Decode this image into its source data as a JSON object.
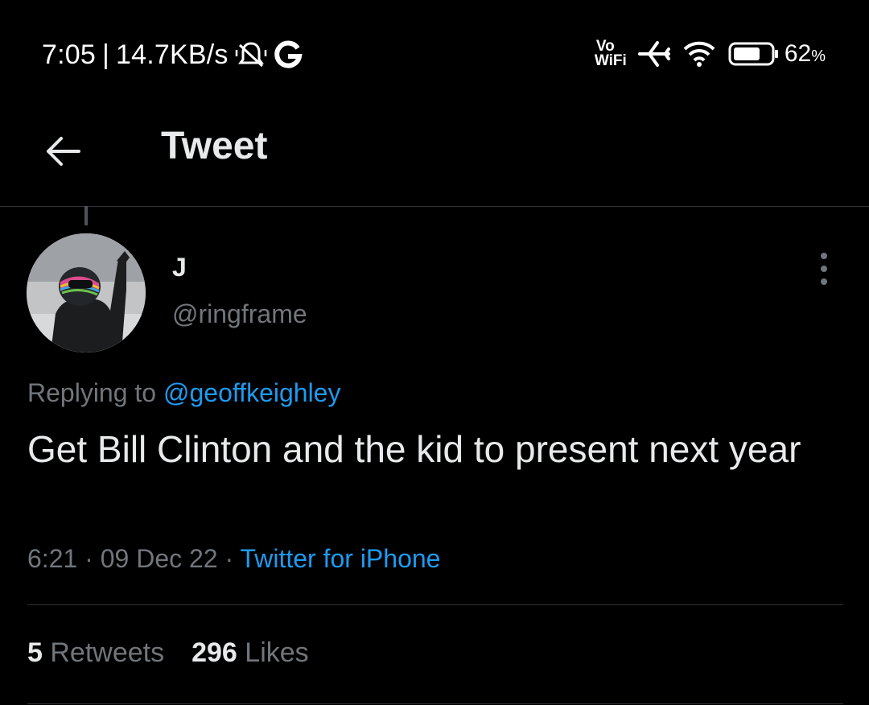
{
  "status_bar": {
    "time": "7:05",
    "separator": "|",
    "speed": "14.7KB/s",
    "icons_left": [
      "silent-bell-icon",
      "google-g-icon"
    ],
    "vo": "Vo",
    "wifi_label": "WiFi",
    "icons_right": [
      "airplane-icon",
      "wifi-signal-icon",
      "battery-icon"
    ],
    "battery_value": "62",
    "battery_unit": "%"
  },
  "header": {
    "back_icon": "arrow-left-icon",
    "title": "Tweet"
  },
  "tweet": {
    "display_name": "J",
    "handle": "@ringframe",
    "replying_prefix": "Replying to",
    "replying_to": "@geoffkeighley",
    "text": "Get Bill Clinton and the kid to present next year",
    "time": "6:21",
    "dot": "·",
    "date": "09 Dec 22",
    "source": "Twitter for iPhone",
    "retweets_count": "5",
    "retweets_label": "Retweets",
    "likes_count": "296",
    "likes_label": "Likes"
  },
  "colors": {
    "background": "#000000",
    "text_primary": "#e7e9ea",
    "text_secondary": "#71767b",
    "link": "#1d9bf0",
    "divider": "#2f3336"
  }
}
